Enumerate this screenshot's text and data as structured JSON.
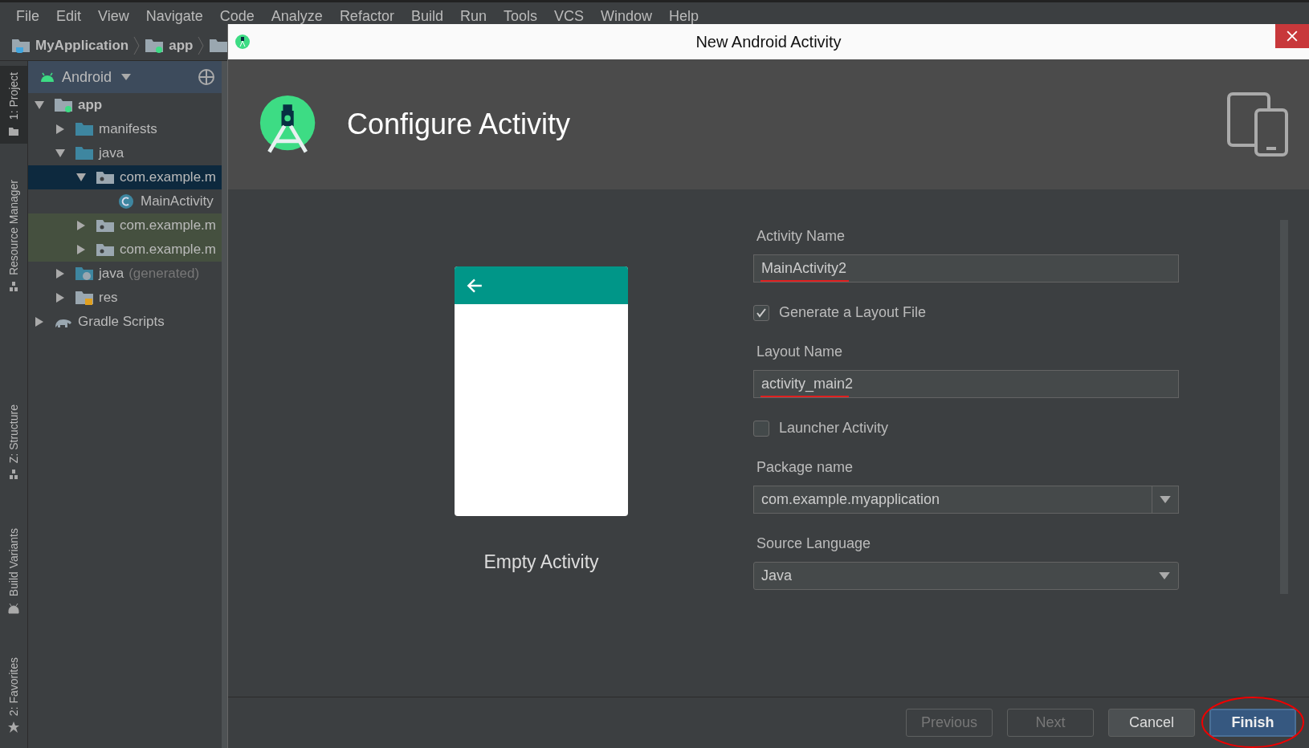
{
  "menu": [
    "File",
    "Edit",
    "View",
    "Navigate",
    "Code",
    "Analyze",
    "Refactor",
    "Build",
    "Run",
    "Tools",
    "VCS",
    "Window",
    "Help"
  ],
  "breadcrumb": [
    {
      "label": "MyApplication",
      "kind": "project"
    },
    {
      "label": "app",
      "kind": "module"
    }
  ],
  "side_tabs": [
    {
      "label": "1: Project",
      "selected": true,
      "kind": "project"
    },
    {
      "label": "Resource Manager",
      "selected": false,
      "kind": "resource"
    },
    {
      "label": "Z: Structure",
      "selected": false,
      "kind": "structure"
    },
    {
      "label": "Build Variants",
      "selected": false,
      "kind": "variants"
    },
    {
      "label": "2: Favorites",
      "selected": false,
      "kind": "favorites"
    }
  ],
  "project_view": {
    "label": "Android"
  },
  "tree": [
    {
      "label": "app",
      "kind": "module",
      "expanded": true,
      "selected": false,
      "highlighted": false,
      "children": [
        {
          "label": "manifests",
          "kind": "folder",
          "expanded": false,
          "selected": false,
          "highlighted": false
        },
        {
          "label": "java",
          "kind": "folder",
          "expanded": true,
          "selected": false,
          "highlighted": false,
          "children": [
            {
              "label": "com.example.m",
              "kind": "package",
              "expanded": true,
              "selected": true,
              "highlighted": false,
              "children": [
                {
                  "label": "MainActivity",
                  "kind": "class",
                  "selected": false,
                  "highlighted": false
                }
              ]
            },
            {
              "label": "com.example.m",
              "kind": "package",
              "expanded": false,
              "selected": false,
              "highlighted": true
            },
            {
              "label": "com.example.m",
              "kind": "package",
              "expanded": false,
              "selected": false,
              "highlighted": true
            }
          ]
        },
        {
          "label": "java",
          "note": "(generated)",
          "kind": "generated",
          "expanded": false,
          "selected": false,
          "highlighted": false
        },
        {
          "label": "res",
          "kind": "res",
          "expanded": false,
          "selected": false,
          "highlighted": false
        }
      ]
    },
    {
      "label": "Gradle Scripts",
      "kind": "gradle",
      "expanded": false,
      "selected": false,
      "highlighted": false
    }
  ],
  "dialog": {
    "title": "New Android Activity",
    "heading": "Configure Activity",
    "preview": {
      "caption": "Empty Activity"
    },
    "form": [
      {
        "kind": "text",
        "label": "Activity Name",
        "value": "MainActivity2",
        "spell_error": true
      },
      {
        "kind": "checkbox",
        "label": "Generate a Layout File",
        "checked": true
      },
      {
        "kind": "text",
        "label": "Layout Name",
        "value": "activity_main2",
        "spell_error": true
      },
      {
        "kind": "checkbox",
        "label": "Launcher Activity",
        "checked": false
      },
      {
        "kind": "combo",
        "label": "Package name",
        "value": "com.example.myapplication"
      },
      {
        "kind": "select",
        "label": "Source Language",
        "value": "Java"
      }
    ],
    "buttons": [
      {
        "label": "Previous",
        "disabled": true,
        "default": false,
        "circled": false
      },
      {
        "label": "Next",
        "disabled": true,
        "default": false,
        "circled": false
      },
      {
        "label": "Cancel",
        "disabled": false,
        "default": false,
        "circled": false
      },
      {
        "label": "Finish",
        "disabled": false,
        "default": true,
        "circled": true
      }
    ]
  }
}
